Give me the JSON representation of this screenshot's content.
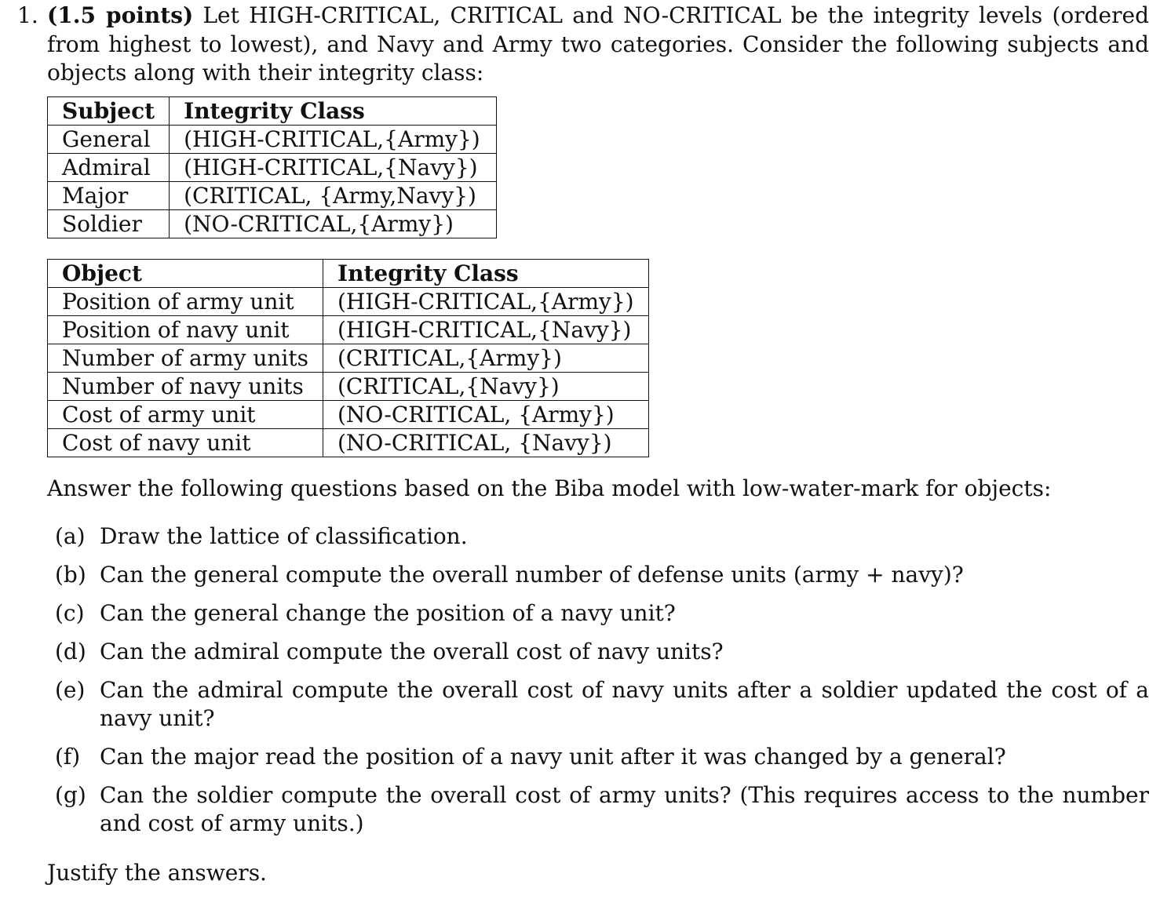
{
  "question": {
    "number": "1.",
    "points": "(1.5 points)",
    "intro": " Let HIGH-CRITICAL, CRITICAL and NO-CRITICAL be the integrity levels (ordered from highest to lowest), and Navy and Army two categories. Consider the following subjects and objects along with their integrity class:"
  },
  "subject_table": {
    "headers": [
      "Subject",
      "Integrity Class"
    ],
    "rows": [
      [
        "General",
        "(HIGH-CRITICAL,{Army})"
      ],
      [
        "Admiral",
        "(HIGH-CRITICAL,{Navy})"
      ],
      [
        "Major",
        "(CRITICAL, {Army,Navy})"
      ],
      [
        "Soldier",
        "(NO-CRITICAL,{Army})"
      ]
    ]
  },
  "object_table": {
    "headers": [
      "Object",
      "Integrity Class"
    ],
    "rows": [
      [
        "Position of army unit",
        "(HIGH-CRITICAL,{Army})"
      ],
      [
        "Position of navy unit",
        "(HIGH-CRITICAL,{Navy})"
      ],
      [
        "Number of army units",
        "(CRITICAL,{Army})"
      ],
      [
        "Number of navy units",
        "(CRITICAL,{Navy})"
      ],
      [
        "Cost of army unit",
        "(NO-CRITICAL, {Army})"
      ],
      [
        "Cost of navy unit",
        "(NO-CRITICAL, {Navy})"
      ]
    ]
  },
  "lead_in": "Answer the following questions based on the Biba model with low-water-mark for objects:",
  "questions": [
    {
      "marker": "(a)",
      "text": "Draw the lattice of classification."
    },
    {
      "marker": "(b)",
      "text": "Can the general compute the overall number of defense units (army + navy)?"
    },
    {
      "marker": "(c)",
      "text": "Can the general change the position of a navy unit?"
    },
    {
      "marker": "(d)",
      "text": "Can the admiral compute the overall cost of navy units?"
    },
    {
      "marker": "(e)",
      "text": "Can the admiral compute the overall cost of navy units after a soldier updated the cost of a navy unit?"
    },
    {
      "marker": "(f)",
      "text": "Can the major read the position of a navy unit after it was changed by a general?"
    },
    {
      "marker": "(g)",
      "text": "Can the soldier compute the overall cost of army units? (This requires access to the number and cost of army units.)"
    }
  ],
  "closing": "Justify the answers."
}
